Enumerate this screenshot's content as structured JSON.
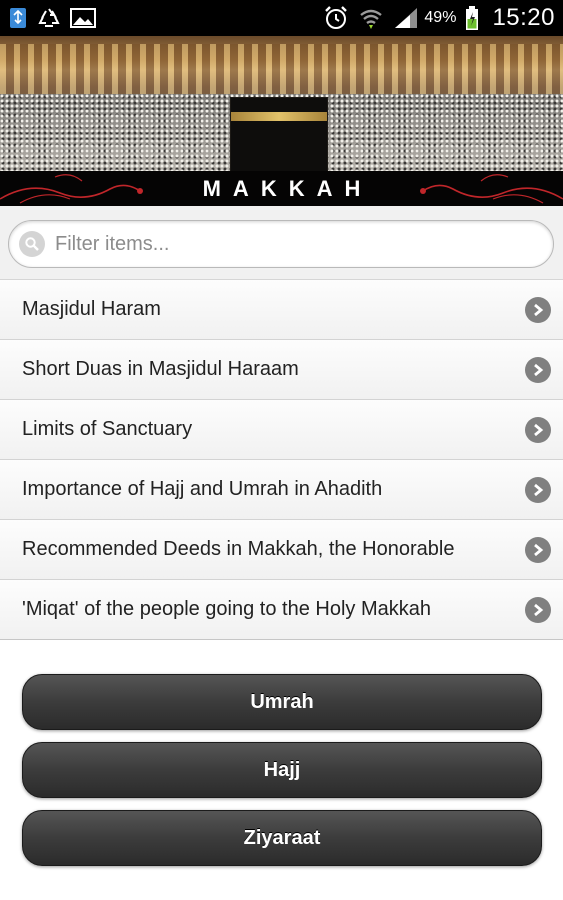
{
  "status_bar": {
    "battery_percent": "49%",
    "time": "15:20",
    "icons": [
      "usb-icon",
      "recycle-icon",
      "image-icon",
      "alarm-icon",
      "wifi-icon",
      "signal-icon",
      "battery-icon"
    ]
  },
  "header": {
    "title": "MAKKAH"
  },
  "filter": {
    "placeholder": "Filter items...",
    "value": ""
  },
  "list": {
    "items": [
      {
        "label": "Masjidul Haram"
      },
      {
        "label": "Short Duas in Masjidul Haraam"
      },
      {
        "label": "Limits of Sanctuary"
      },
      {
        "label": "Importance of Hajj and Umrah in Ahadith"
      },
      {
        "label": "Recommended Deeds in Makkah, the Honorable"
      },
      {
        "label": "'Miqat' of the people going to the Holy Makkah"
      }
    ]
  },
  "buttons": {
    "umrah": "Umrah",
    "hajj": "Hajj",
    "ziyaraat": "Ziyaraat"
  },
  "colors": {
    "status_bar_bg": "#000000",
    "list_bg": "#f5f5f5",
    "chevron": "#808080",
    "button_bg": "#3c3c3c",
    "accent_red": "#c0262a"
  }
}
